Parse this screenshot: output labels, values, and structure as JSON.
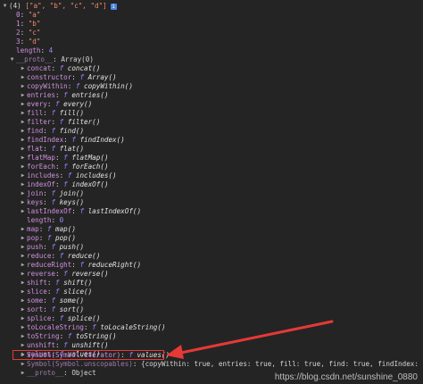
{
  "header": {
    "count": "(4)",
    "preview": "[\"a\", \"b\", \"c\", \"d\"]"
  },
  "elements": [
    {
      "index": "0",
      "value": "\"a\""
    },
    {
      "index": "1",
      "value": "\"b\""
    },
    {
      "index": "2",
      "value": "\"c\""
    },
    {
      "index": "3",
      "value": "\"d\""
    }
  ],
  "length_row": {
    "key": "length",
    "value": "4"
  },
  "proto_row": {
    "key": "__proto__",
    "value": "Array(0)"
  },
  "methods": [
    {
      "key": "concat",
      "fn": "concat()"
    },
    {
      "key": "constructor",
      "fn": "Array()"
    },
    {
      "key": "copyWithin",
      "fn": "copyWithin()"
    },
    {
      "key": "entries",
      "fn": "entries()"
    },
    {
      "key": "every",
      "fn": "every()"
    },
    {
      "key": "fill",
      "fn": "fill()"
    },
    {
      "key": "filter",
      "fn": "filter()"
    },
    {
      "key": "find",
      "fn": "find()"
    },
    {
      "key": "findIndex",
      "fn": "findIndex()"
    },
    {
      "key": "flat",
      "fn": "flat()"
    },
    {
      "key": "flatMap",
      "fn": "flatMap()"
    },
    {
      "key": "forEach",
      "fn": "forEach()"
    },
    {
      "key": "includes",
      "fn": "includes()"
    },
    {
      "key": "indexOf",
      "fn": "indexOf()"
    },
    {
      "key": "join",
      "fn": "join()"
    },
    {
      "key": "keys",
      "fn": "keys()"
    },
    {
      "key": "lastIndexOf",
      "fn": "lastIndexOf()"
    }
  ],
  "proto_length": {
    "key": "length",
    "value": "0"
  },
  "methods2": [
    {
      "key": "map",
      "fn": "map()"
    },
    {
      "key": "pop",
      "fn": "pop()"
    },
    {
      "key": "push",
      "fn": "push()"
    },
    {
      "key": "reduce",
      "fn": "reduce()"
    },
    {
      "key": "reduceRight",
      "fn": "reduceRight()"
    },
    {
      "key": "reverse",
      "fn": "reverse()"
    },
    {
      "key": "shift",
      "fn": "shift()"
    },
    {
      "key": "slice",
      "fn": "slice()"
    },
    {
      "key": "some",
      "fn": "some()"
    },
    {
      "key": "sort",
      "fn": "sort()"
    },
    {
      "key": "splice",
      "fn": "splice()"
    },
    {
      "key": "toLocaleString",
      "fn": "toLocaleString()"
    },
    {
      "key": "toString",
      "fn": "toString()"
    },
    {
      "key": "unshift",
      "fn": "unshift()"
    },
    {
      "key": "values",
      "fn": "values()"
    }
  ],
  "symbol_iterator": {
    "key": "Symbol(Symbol.iterator)",
    "fn": "values()"
  },
  "symbol_unscopables": {
    "key": "Symbol(Symbol.unscopables)",
    "value": "{copyWithin: true, entries: true, fill: true, find: true, findIndex: true, …}"
  },
  "inner_proto": {
    "key": "__proto__",
    "value": "Object"
  },
  "f_marker": "f",
  "watermark": "https://blog.csdn.net/sunshine_0880",
  "colors": {
    "highlight": "#e53935",
    "background": "#242424"
  }
}
